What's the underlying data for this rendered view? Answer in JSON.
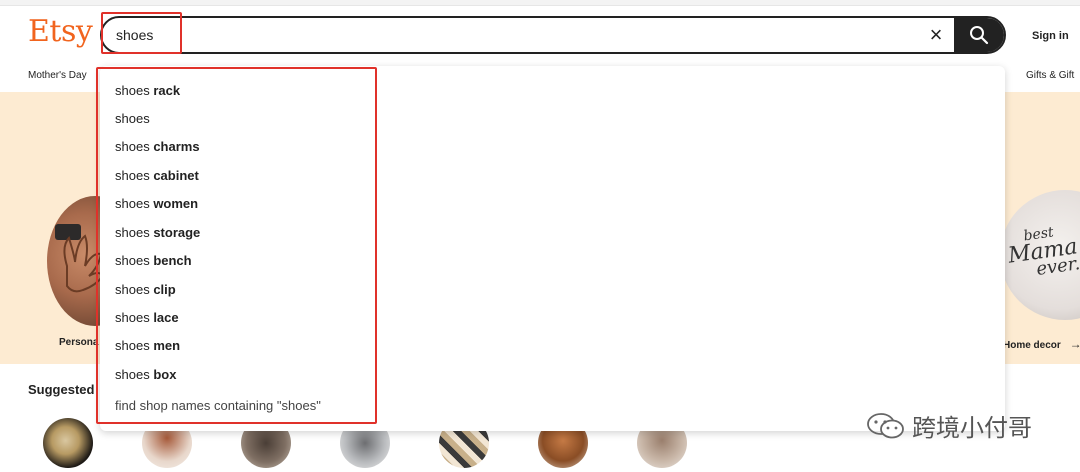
{
  "header": {
    "logo": "Etsy",
    "search_value": "shoes",
    "sign_in": "Sign in"
  },
  "nav": {
    "left": "Mother's Day",
    "right": "Gifts & Gift"
  },
  "hero": {
    "left_label": "Persona",
    "right_label": "Home decor",
    "right_arrow": "→",
    "mug_text_1": "best",
    "mug_text_2": "Mama",
    "mug_text_3": "ever."
  },
  "suggested_title": "Suggested",
  "suggestions": [
    {
      "prefix": "shoes ",
      "bold": "rack"
    },
    {
      "prefix": "shoes",
      "bold": ""
    },
    {
      "prefix": "shoes ",
      "bold": "charms"
    },
    {
      "prefix": "shoes ",
      "bold": "cabinet"
    },
    {
      "prefix": "shoes ",
      "bold": "women"
    },
    {
      "prefix": "shoes ",
      "bold": "storage"
    },
    {
      "prefix": "shoes ",
      "bold": "bench"
    },
    {
      "prefix": "shoes ",
      "bold": "clip"
    },
    {
      "prefix": "shoes ",
      "bold": "lace"
    },
    {
      "prefix": "shoes ",
      "bold": "men"
    },
    {
      "prefix": "shoes ",
      "bold": "box"
    }
  ],
  "find_shop": "find shop names containing \"shoes\"",
  "watermark": "跨境小付哥",
  "colors": {
    "brand": "#f1641e",
    "highlight_box": "#e0312a",
    "hero_bg": "#fdebd2"
  },
  "icons": [
    "close-icon",
    "search-icon",
    "wechat-icon"
  ]
}
